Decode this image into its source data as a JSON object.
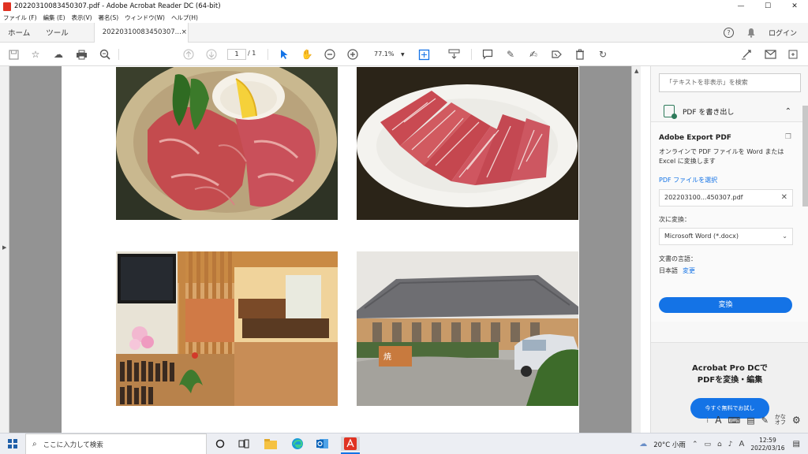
{
  "window": {
    "title": "20220310083450307.pdf - Adobe Acrobat Reader DC (64-bit)",
    "controls": {
      "minimize": "—",
      "maximize": "☐",
      "close": "✕"
    }
  },
  "menu": [
    "ファイル (F)",
    "編集 (E)",
    "表示(V)",
    "署名(S)",
    "ウィンドウ(W)",
    "ヘルプ(H)"
  ],
  "tabs": {
    "home": "ホーム",
    "tools": "ツール",
    "doc": "20220310083450307...",
    "doc_close": "×"
  },
  "account": {
    "help": "?",
    "login": "ログイン"
  },
  "toolbar": {
    "page_current": "1",
    "page_total": "/ 1",
    "zoom": "77.1%"
  },
  "right_panel": {
    "search_placeholder": "「テキストを非表示」を検索",
    "export_title": "PDF を書き出し",
    "card_title": "Adobe Export PDF",
    "description": "オンラインで PDF ファイルを Word または Excel に変換します",
    "select_file_link": "PDF ファイルを選択",
    "file_name": "202203100...450307.pdf",
    "convert_to_label": "次に変換：",
    "convert_format": "Microsoft Word (*.docx)",
    "doc_lang_label": "文書の言語：",
    "doc_lang": "日本語",
    "change_link": "変更",
    "convert_button": "変換",
    "promo_line1": "Acrobat Pro DCで",
    "promo_line2": "PDFを変換・編集",
    "promo_button": "今すぐ無料でお試し"
  },
  "taskbar": {
    "search_placeholder": "ここに入力して検索",
    "weather": "20°C 小雨",
    "time": "12:59",
    "date": "2022/03/16",
    "ime": "A"
  },
  "colors": {
    "accent": "#1473e6",
    "acrobat_red": "#e03222",
    "export_green": "#2d7a5a"
  }
}
